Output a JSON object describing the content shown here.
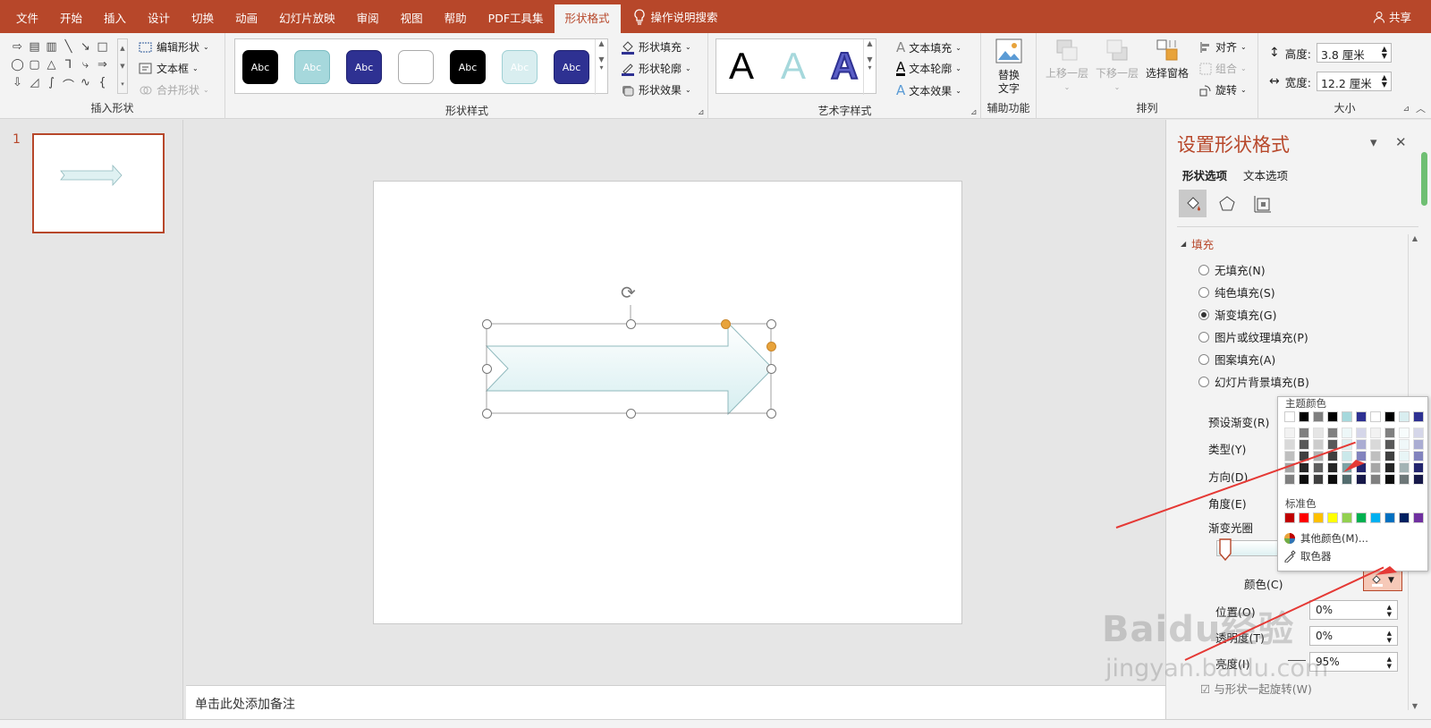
{
  "tabs": [
    "文件",
    "开始",
    "插入",
    "设计",
    "切换",
    "动画",
    "幻灯片放映",
    "审阅",
    "视图",
    "帮助",
    "PDF工具集",
    "形状格式"
  ],
  "active_tab": "形状格式",
  "search_label": "操作说明搜索",
  "share_label": "共享",
  "ribbon": {
    "insert_shapes": {
      "label": "插入形状",
      "edit_shape": "编辑形状",
      "text_box": "文本框",
      "merge_shapes": "合并形状"
    },
    "shape_styles": {
      "label": "形状样式",
      "swatch_text": "Abc",
      "fill": "形状填充",
      "outline": "形状轮廓",
      "effects": "形状效果"
    },
    "wordart": {
      "label": "艺术字样式",
      "glyph": "A",
      "text_fill": "文本填充",
      "text_outline": "文本轮廓",
      "text_effects": "文本效果"
    },
    "accessibility": {
      "label": "辅助功能",
      "alt_text_line1": "替换",
      "alt_text_line2": "文字"
    },
    "arrange": {
      "label": "排列",
      "bring_forward": "上移一层",
      "send_backward": "下移一层",
      "selection_pane": "选择窗格",
      "align": "对齐",
      "group": "组合",
      "rotate": "旋转"
    },
    "size": {
      "label": "大小",
      "height_label": "高度:",
      "height_value": "3.8 厘米",
      "width_label": "宽度:",
      "width_value": "12.2 厘米"
    }
  },
  "thumbnail": {
    "number": "1"
  },
  "notes_placeholder": "单击此处添加备注",
  "format_pane": {
    "title": "设置形状格式",
    "tab_shape": "形状选项",
    "tab_text": "文本选项",
    "section_fill": "填充",
    "fill_options": [
      "无填充(N)",
      "纯色填充(S)",
      "渐变填充(G)",
      "图片或纹理填充(P)",
      "图案填充(A)",
      "幻灯片背景填充(B)"
    ],
    "selected_fill": "渐变填充(G)",
    "preset_gradient": "预设渐变(R)",
    "type": "类型(Y)",
    "direction": "方向(D)",
    "angle": "角度(E)",
    "gradient_stops": "渐变光圈",
    "color": "颜色(C)",
    "position": "位置(O)",
    "position_value": "0%",
    "transparency": "透明度(T)",
    "transparency_value": "0%",
    "brightness": "亮度(I)",
    "brightness_value": "95%",
    "rotate_with_shape": "与形状一起旋转(W)"
  },
  "color_popup": {
    "theme_colors": "主题颜色",
    "standard_colors": "标准色",
    "more_colors": "其他颜色(M)...",
    "eyedropper": "取色器",
    "theme_top": [
      "#ffffff",
      "#000000",
      "#7f7f7f",
      "#000000",
      "#a6d8dc",
      "#2e3192",
      "#ffffff",
      "#000000",
      "#d9eef0",
      "#2e3192"
    ],
    "standard": [
      "#c00000",
      "#ff0000",
      "#ffc000",
      "#ffff00",
      "#92d050",
      "#00b050",
      "#00b0f0",
      "#0070c0",
      "#002060",
      "#7030a0"
    ]
  },
  "watermark": {
    "brand": "Baidu经验",
    "url": "jingyan.baidu.com"
  },
  "colors": {
    "accent": "#b7472a",
    "annotation_red": "#e53935",
    "arrow_fill": "#dff1f2"
  }
}
